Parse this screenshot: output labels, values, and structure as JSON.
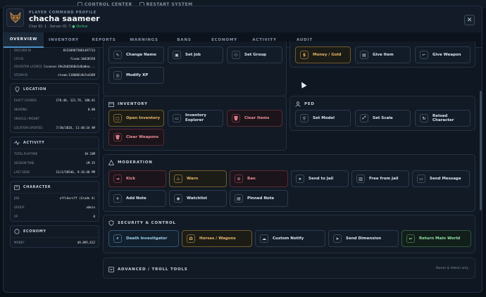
{
  "background_bar": {
    "control_center": "CONTROL CENTER",
    "restart_system": "RESTART SYSTEM"
  },
  "header": {
    "eyebrow": "PLAYER COMMAND PROFILE",
    "name": "chacha saameer",
    "meta": "Char ID: 1 · Server ID: 7",
    "status": "● Online"
  },
  "tabs": [
    "OVERVIEW",
    "INVENTORY",
    "REPORTS",
    "WARNINGS",
    "BANS",
    "ECONOMY",
    "ACTIVITY",
    "AUDIT"
  ],
  "active_tab": "OVERVIEW",
  "identity": {
    "rows": [
      {
        "label": "DISCORD ID",
        "value": "815389875881497733"
      },
      {
        "label": "CFX ID",
        "value": "fivem:10428358"
      },
      {
        "label": "ROCKSTAR LICENCE",
        "value": "license:39e2b82668d1d6a0ea..."
      },
      {
        "label": "STEAM ID",
        "value": "steam:11000014b7e4309"
      }
    ]
  },
  "location": {
    "title": "LOCATION",
    "rows": [
      {
        "label": "EXACT COORDS",
        "value": "178.48, 121.79, 180.81"
      },
      {
        "label": "HEADING",
        "value": "0.00"
      },
      {
        "label": "VEHICLE / MOUNT",
        "value": "-"
      },
      {
        "label": "LOCATION UPDATED",
        "value": "7/30/2026, 11:48:34 AM"
      }
    ]
  },
  "activity": {
    "title": "ACTIVITY",
    "rows": [
      {
        "label": "TOTAL PLAYTIME",
        "value": "1H 33M"
      },
      {
        "label": "SESSION TIME",
        "value": "1M 25"
      },
      {
        "label": "LAST SEEN",
        "value": "12/2/58546, 9:16:40 PM"
      }
    ]
  },
  "character": {
    "title": "CHARACTER",
    "rows": [
      {
        "label": "JOB",
        "value": "offsheriff (Grade 4)"
      },
      {
        "label": "GROUP",
        "value": "admin"
      },
      {
        "label": "XP",
        "value": "0"
      }
    ]
  },
  "economy": {
    "title": "ECONOMY",
    "rows": [
      {
        "label": "MONEY",
        "value": "$9,895,612"
      }
    ]
  },
  "top_left_buttons": [
    "Change Name",
    "Set Job",
    "Set Group",
    "Modify XP"
  ],
  "top_right_buttons": [
    "Money / Gold",
    "Give Item",
    "Give Weapon"
  ],
  "inventory": {
    "title": "INVENTORY",
    "buttons": [
      "Open Inventory",
      "Inventory Explorer",
      "Clear Items",
      "Clear Weapons"
    ]
  },
  "ped": {
    "title": "PED",
    "buttons": [
      "Set Model",
      "Set Scale",
      "Reload Character"
    ]
  },
  "moderation": {
    "title": "MODERATION",
    "buttons": [
      "Kick",
      "Warn",
      "Ban",
      "Send to Jail",
      "Free from Jail",
      "Send Message",
      "Add Note",
      "Watchlist",
      "Pinned Note"
    ]
  },
  "security": {
    "title": "SECURITY & CONTROL",
    "buttons": [
      "Death Investigator",
      "Horses / Wagons",
      "Custom Notify",
      "Send Dimension",
      "Return Main World"
    ]
  },
  "advanced": {
    "title": "ADVANCED / TROLL TOOLS",
    "note": "Owner & Admin only"
  },
  "colors": {
    "accent": "#4a90c6",
    "gold": "#e6b86b",
    "danger": "#ef8d93",
    "success": "#3fc877",
    "panel": "#111a25"
  }
}
